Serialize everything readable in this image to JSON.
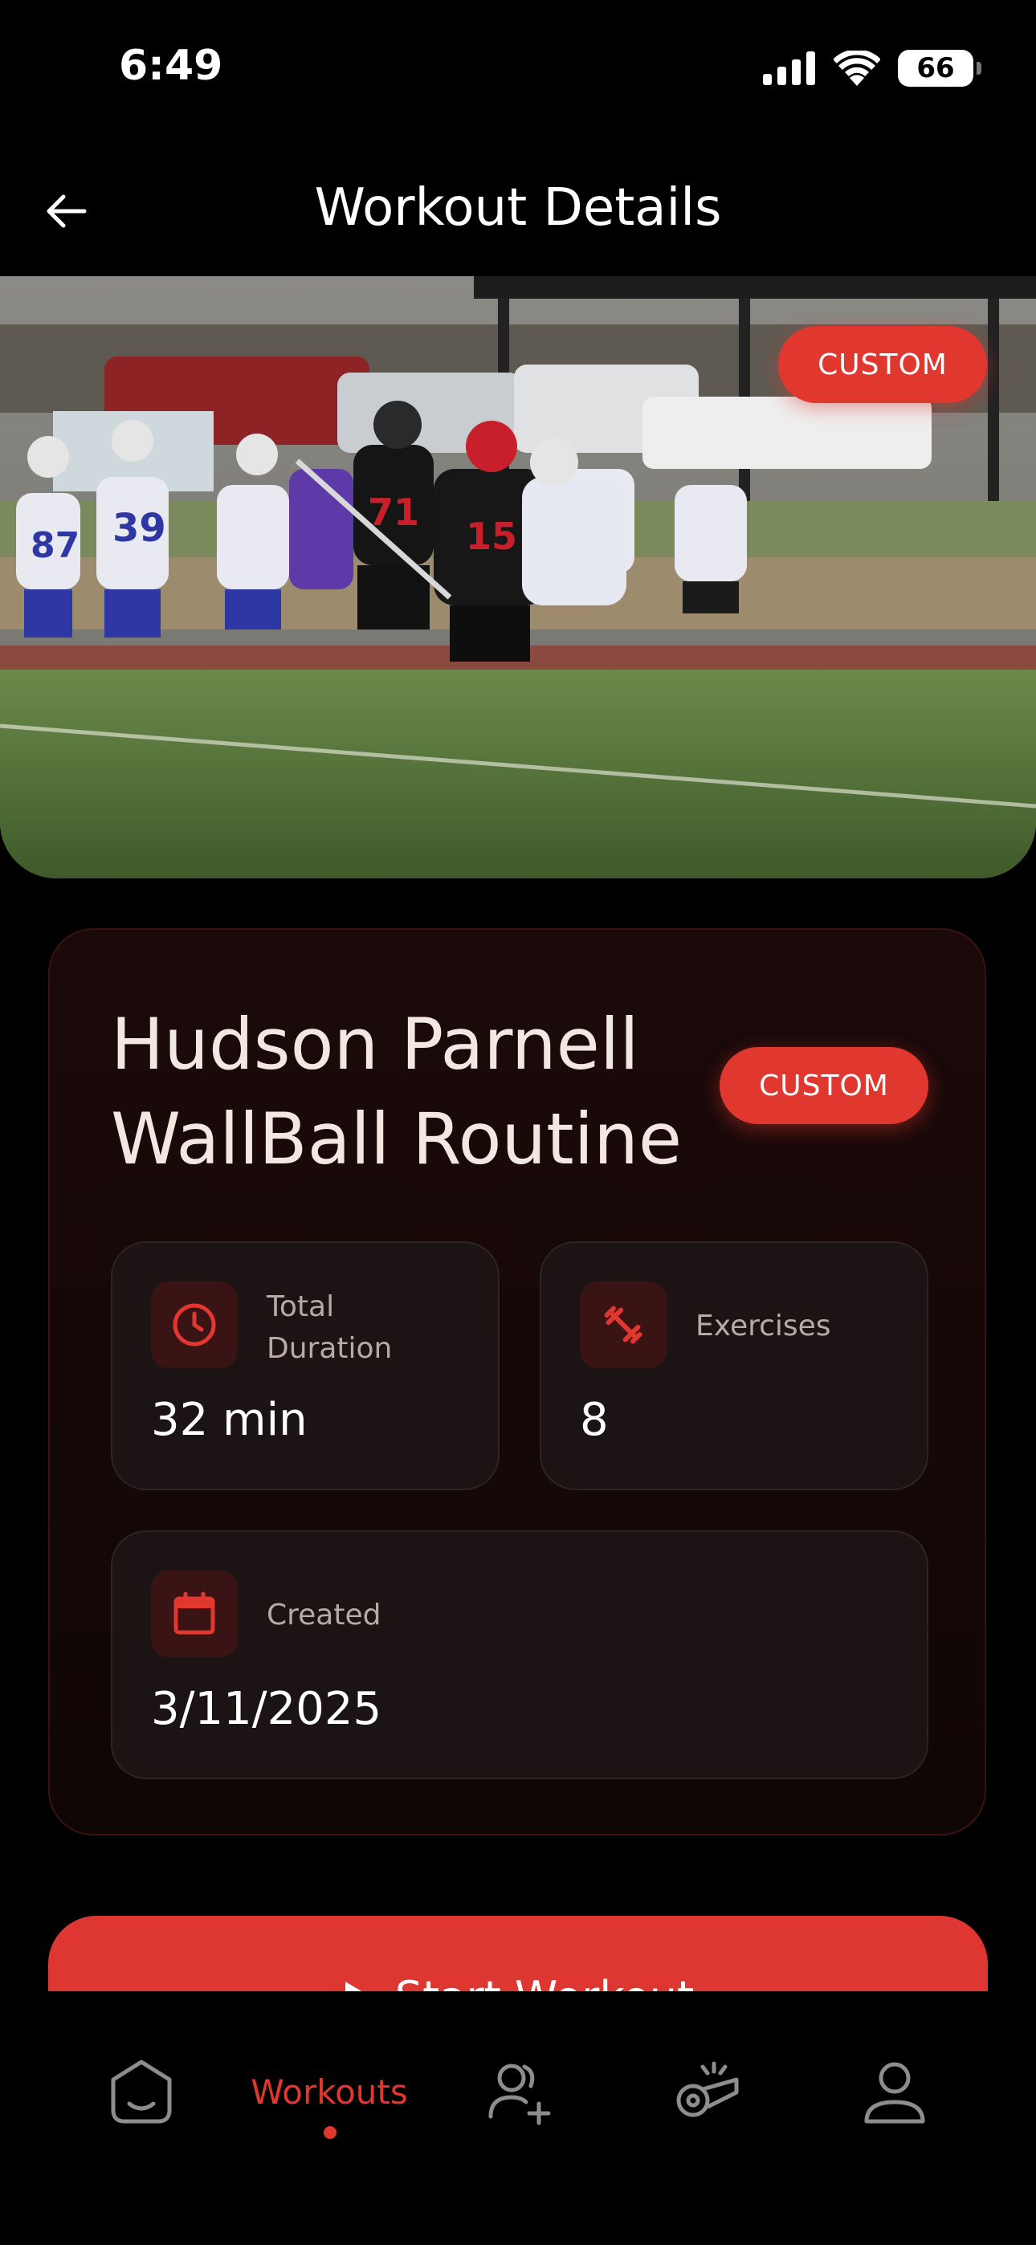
{
  "status_bar": {
    "time": "6:49",
    "battery": "66"
  },
  "header": {
    "title": "Workout Details"
  },
  "hero": {
    "badge": "CUSTOM",
    "jersey_numbers": [
      "87",
      "39",
      "71",
      "15"
    ]
  },
  "workout": {
    "name": "Hudson Parnell WallBall Routine",
    "badge": "CUSTOM",
    "stats": {
      "duration": {
        "label": "Total Duration",
        "value": "32 min"
      },
      "exercises": {
        "label": "Exercises",
        "value": "8"
      },
      "created": {
        "label": "Created",
        "value": "3/11/2025"
      }
    }
  },
  "start_button": {
    "label": "Start Workout"
  },
  "tab_bar": {
    "active_label": "Workouts"
  },
  "colors": {
    "accent": "#e0372f",
    "background": "#000000",
    "card": "#170909"
  },
  "icons": [
    "arrow-left-icon",
    "clock-icon",
    "dumbbell-icon",
    "calendar-icon",
    "play-icon",
    "home-icon",
    "add-user-icon",
    "whistle-icon",
    "profile-icon"
  ]
}
